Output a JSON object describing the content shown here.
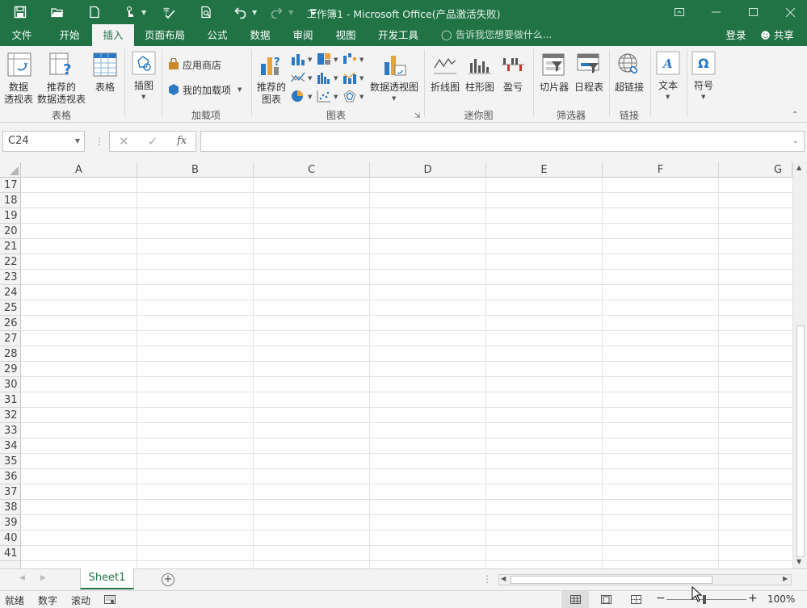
{
  "window": {
    "title": "工作簿1 - Microsoft Office(产品激活失败)"
  },
  "ribbon_tabs": [
    "文件",
    "开始",
    "插入",
    "页面布局",
    "公式",
    "数据",
    "审阅",
    "视图",
    "开发工具"
  ],
  "active_tab": "插入",
  "tell_me": "告诉我您想要做什么...",
  "account": {
    "login": "登录",
    "share": "共享"
  },
  "groups": {
    "tables": {
      "label": "表格",
      "pivot_line1": "数据",
      "pivot_line2": "透视表",
      "rec_pivot_line1": "推荐的",
      "rec_pivot_line2": "数据透视表",
      "table": "表格"
    },
    "illustrations": {
      "label": "插图"
    },
    "addins": {
      "label": "加载项",
      "store": "应用商店",
      "my_addins": "我的加载项"
    },
    "charts": {
      "label": "图表",
      "rec_line1": "推荐的",
      "rec_line2": "图表",
      "pivot_chart": "数据透视图"
    },
    "sparklines": {
      "label": "迷你图",
      "line": "折线图",
      "column": "柱形图",
      "winloss": "盈亏"
    },
    "filters": {
      "label": "筛选器",
      "slicer": "切片器",
      "timeline": "日程表"
    },
    "links": {
      "label": "链接",
      "hyperlink": "超链接"
    },
    "text": {
      "label": "文本"
    },
    "symbols": {
      "label": "符号"
    }
  },
  "formula_bar": {
    "name_box": "C24",
    "fx": "fx",
    "formula": ""
  },
  "sheet": {
    "columns": [
      "A",
      "B",
      "C",
      "D",
      "E",
      "F",
      "G"
    ],
    "rows": [
      "17",
      "18",
      "19",
      "20",
      "21",
      "22",
      "23",
      "24",
      "25",
      "26",
      "27",
      "28",
      "29",
      "30",
      "31",
      "32",
      "33",
      "34",
      "35",
      "36",
      "37",
      "38",
      "39",
      "40",
      "41"
    ],
    "tabs": [
      "Sheet1"
    ]
  },
  "status": {
    "ready": "就绪",
    "num": "数字",
    "scroll": "滚动",
    "zoom": "100%"
  },
  "colors": {
    "brand": "#217346"
  }
}
